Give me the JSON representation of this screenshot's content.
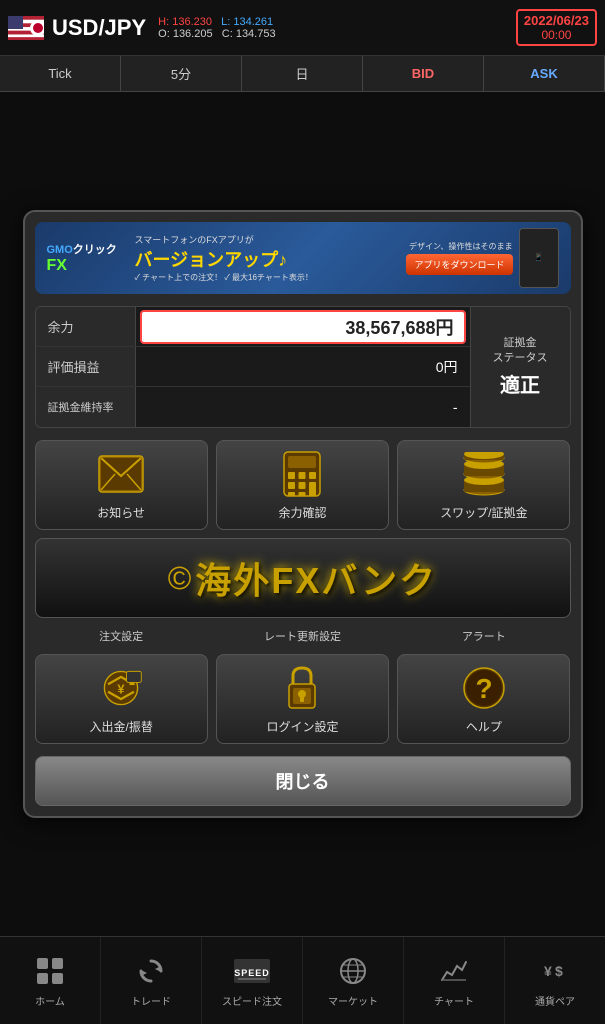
{
  "header": {
    "pair": "USD/JPY",
    "high": "H: 136.230",
    "low": "L: 134.261",
    "open": "O: 136.205",
    "close": "C: 134.753",
    "date": "2022/06/23",
    "time": "00:00"
  },
  "tabs": [
    {
      "label": "Tick"
    },
    {
      "label": "5分"
    },
    {
      "label": "日"
    },
    {
      "label": "BID",
      "type": "bid"
    },
    {
      "label": "ASK",
      "type": "ask"
    }
  ],
  "banner": {
    "logo_text": "GMOクリック FX",
    "sub_text": "スマートフォンのFXアプリが",
    "main_text": "バージョンアップ♪",
    "feature1": "✓ チャート上での注文！",
    "feature2": "✓ 最大16チャート表示！",
    "dl_button": "アプリをダウンロード",
    "tagline": "デザイン、操作性はそのまま"
  },
  "account": {
    "balance_label": "余力",
    "balance_value": "38,567,688円",
    "eval_label": "評価損益",
    "eval_value": "0円",
    "margin_label": "証拠金維持率",
    "margin_value": "-",
    "status_label": "証拠金\nステータス",
    "status_value": "適正"
  },
  "menu_row1": [
    {
      "label": "お知らせ",
      "icon": "envelope"
    },
    {
      "label": "余力確認",
      "icon": "calculator"
    },
    {
      "label": "スワップ/証拠金",
      "icon": "coins"
    }
  ],
  "kaigai_banner": {
    "text": "© 海外FXバンク"
  },
  "menu_sub": [
    {
      "label": "注文設定"
    },
    {
      "label": "レート更新設定"
    },
    {
      "label": "アラート"
    }
  ],
  "menu_row2": [
    {
      "label": "入出金/振替",
      "icon": "transfer"
    },
    {
      "label": "ログイン設定",
      "icon": "lock"
    },
    {
      "label": "ヘルプ",
      "icon": "help"
    }
  ],
  "close_button": "閉じる",
  "bottom_nav": [
    {
      "label": "ホーム",
      "icon": "grid"
    },
    {
      "label": "トレード",
      "icon": "refresh"
    },
    {
      "label": "スピード注文",
      "icon": "speed"
    },
    {
      "label": "マーケット",
      "icon": "globe"
    },
    {
      "label": "チャート",
      "icon": "chart"
    },
    {
      "label": "通貨ペア",
      "icon": "currency"
    }
  ]
}
